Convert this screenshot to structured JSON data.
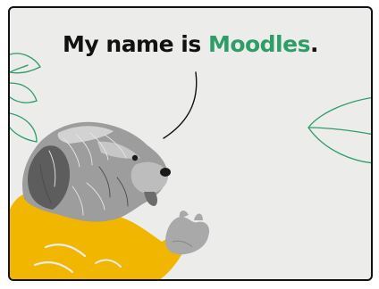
{
  "headline": {
    "prefix": "My name is ",
    "name": "Moodles",
    "suffix": "."
  },
  "colors": {
    "background": "#ececeb",
    "accent_green": "#2e9d68",
    "sweater_yellow": "#f0b600",
    "border": "#111111"
  },
  "icons": {
    "speech_pointer": "speech-tail-line",
    "left_leaf": "leaf-outline",
    "right_leaf": "leaf-outline"
  }
}
